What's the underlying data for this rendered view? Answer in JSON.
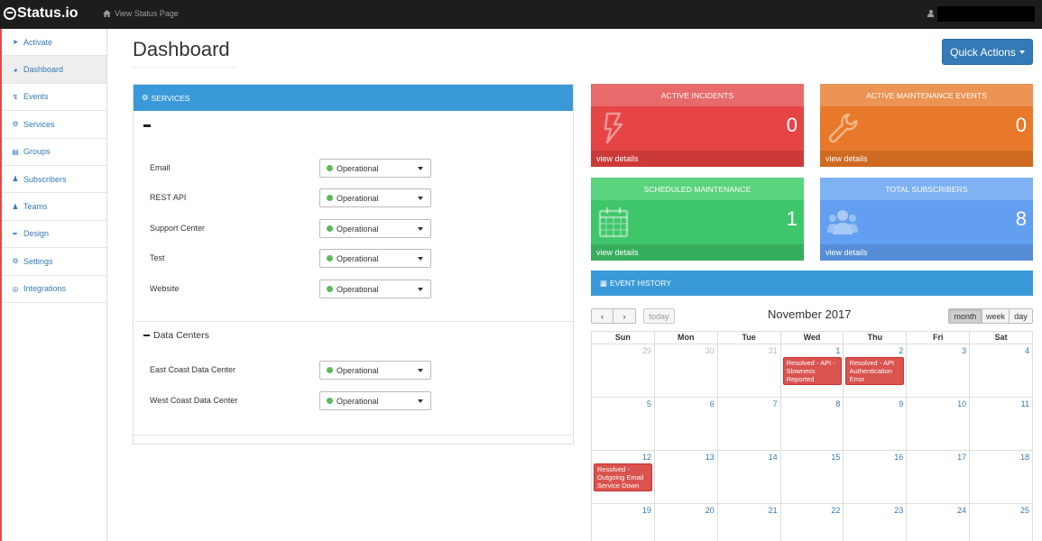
{
  "topbar": {
    "logo_text": "Status.io",
    "view_status_label": "View Status Page"
  },
  "sidebar": {
    "items": [
      {
        "label": "Activate",
        "icon": "rocket-icon"
      },
      {
        "label": "Dashboard",
        "icon": "dashboard-icon"
      },
      {
        "label": "Events",
        "icon": "bolt-icon"
      },
      {
        "label": "Services",
        "icon": "cogs-icon"
      },
      {
        "label": "Groups",
        "icon": "list-icon"
      },
      {
        "label": "Subscribers",
        "icon": "user-plus-icon"
      },
      {
        "label": "Teams",
        "icon": "users-icon"
      },
      {
        "label": "Design",
        "icon": "brush-icon"
      },
      {
        "label": "Settings",
        "icon": "gear-icon"
      },
      {
        "label": "Integrations",
        "icon": "plug-icon"
      }
    ],
    "active": "Dashboard"
  },
  "page": {
    "title": "Dashboard",
    "quick_actions_label": "Quick Actions"
  },
  "services": {
    "header": "SERVICES",
    "group_label": "-",
    "items": [
      {
        "name": "Email",
        "status": "Operational"
      },
      {
        "name": "REST API",
        "status": "Operational"
      },
      {
        "name": "Support Center",
        "status": "Operational"
      },
      {
        "name": "Test",
        "status": "Operational"
      },
      {
        "name": "Website",
        "status": "Operational"
      }
    ],
    "data_centers_label": "Data Centers",
    "data_centers": [
      {
        "name": "East Coast Data Center",
        "status": "Operational"
      },
      {
        "name": "West Coast Data Center",
        "status": "Operational"
      }
    ],
    "status_color": "#5cb85c"
  },
  "stats": [
    {
      "title": "ACTIVE INCIDENTS",
      "value": "0",
      "footer": "view details",
      "icon": "bolt-icon",
      "color_head": "#e86b6b",
      "color_body": "#e64545",
      "color_foot": "#cc3939"
    },
    {
      "title": "ACTIVE MAINTENANCE EVENTS",
      "value": "0",
      "footer": "view details",
      "icon": "wrench-icon",
      "color_head": "#eb9454",
      "color_body": "#e8792a",
      "color_foot": "#cf6a22"
    },
    {
      "title": "SCHEDULED MAINTENANCE",
      "value": "1",
      "footer": "view details",
      "icon": "calendar-icon",
      "color_head": "#5bd37f",
      "color_body": "#3fc66a",
      "color_foot": "#36ad5c"
    },
    {
      "title": "TOTAL SUBSCRIBERS",
      "value": "8",
      "footer": "view details",
      "icon": "users-icon",
      "color_head": "#7fb2f2",
      "color_body": "#629ff0",
      "color_foot": "#558dd7"
    }
  ],
  "events": {
    "header": "EVENT HISTORY",
    "today_label": "today",
    "month_title": "November 2017",
    "views": [
      "month",
      "week",
      "day"
    ],
    "active_view": "month",
    "days_of_week": [
      "Sun",
      "Mon",
      "Tue",
      "Wed",
      "Thu",
      "Fri",
      "Sat"
    ],
    "weeks": [
      [
        {
          "d": "29",
          "other": true
        },
        {
          "d": "30",
          "other": true
        },
        {
          "d": "31",
          "other": true
        },
        {
          "d": "1",
          "event": "Resolved - API - Slowness Reported"
        },
        {
          "d": "2",
          "event": "Resolved - API Authentication Error"
        },
        {
          "d": "3"
        },
        {
          "d": "4"
        }
      ],
      [
        {
          "d": "5"
        },
        {
          "d": "6"
        },
        {
          "d": "7"
        },
        {
          "d": "8"
        },
        {
          "d": "9"
        },
        {
          "d": "10"
        },
        {
          "d": "11"
        }
      ],
      [
        {
          "d": "12",
          "event": "Resolved - Outgoing Email Service Down"
        },
        {
          "d": "13"
        },
        {
          "d": "14"
        },
        {
          "d": "15"
        },
        {
          "d": "16"
        },
        {
          "d": "17"
        },
        {
          "d": "18"
        }
      ],
      [
        {
          "d": "19"
        },
        {
          "d": "20"
        },
        {
          "d": "21"
        },
        {
          "d": "22"
        },
        {
          "d": "23"
        },
        {
          "d": "24"
        },
        {
          "d": "25"
        }
      ]
    ],
    "event_color": "#d9534f"
  }
}
